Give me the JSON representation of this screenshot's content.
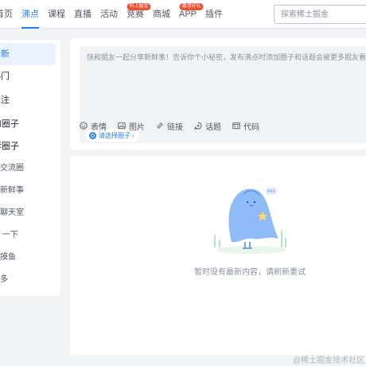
{
  "nav": {
    "items": [
      {
        "label": "首页",
        "active": false,
        "badge": ""
      },
      {
        "label": "沸点",
        "active": true,
        "badge": ""
      },
      {
        "label": "课程",
        "active": false,
        "badge": ""
      },
      {
        "label": "直播",
        "active": false,
        "badge": ""
      },
      {
        "label": "活动",
        "active": false,
        "badge": ""
      },
      {
        "label": "竞赛",
        "active": false,
        "badge": "码上掘金"
      },
      {
        "label": "商城",
        "active": false,
        "badge": ""
      },
      {
        "label": "APP",
        "active": false,
        "badge": "邀请好礼"
      },
      {
        "label": "插件",
        "active": false,
        "badge": ""
      }
    ],
    "search_placeholder": "探索稀土掘金"
  },
  "sidebar": {
    "items": [
      {
        "label": "最新",
        "active": true
      },
      {
        "label": "热门",
        "active": false
      },
      {
        "label": "关注",
        "active": false
      },
      {
        "label": "我的圈子",
        "active": false
      },
      {
        "label": "推荐圈子",
        "active": false
      },
      {
        "label": "技术交流圈",
        "active": false
      },
      {
        "label": "每日新鲜事",
        "active": false
      },
      {
        "label": "上班聊天室",
        "active": false
      },
      {
        "label": "今天学到了什么 一下",
        "active": false
      },
      {
        "label": "上班摸鱼",
        "active": false
      },
      {
        "label": "更多",
        "active": false
      }
    ]
  },
  "composer": {
    "placeholder": "快和掘友一起分享新鲜事！告诉你个小秘密，发布沸点时添加圈子和话题会被更多掘友看到",
    "circle_chip": "请选择圈子",
    "tools": [
      {
        "label": "表情",
        "icon": "smile-icon"
      },
      {
        "label": "图片",
        "icon": "image-icon"
      },
      {
        "label": "链接",
        "icon": "link-icon"
      },
      {
        "label": "话题",
        "icon": "topic-icon"
      },
      {
        "label": "代码",
        "icon": "code-icon"
      }
    ]
  },
  "feed": {
    "empty_message": "暂时没有最新内容，请刷新重试"
  },
  "watermark": "@稀土掘金技术社区",
  "colors": {
    "accent": "#1e80ff",
    "badge": "#ee502f",
    "background": "#f2f3f5"
  }
}
